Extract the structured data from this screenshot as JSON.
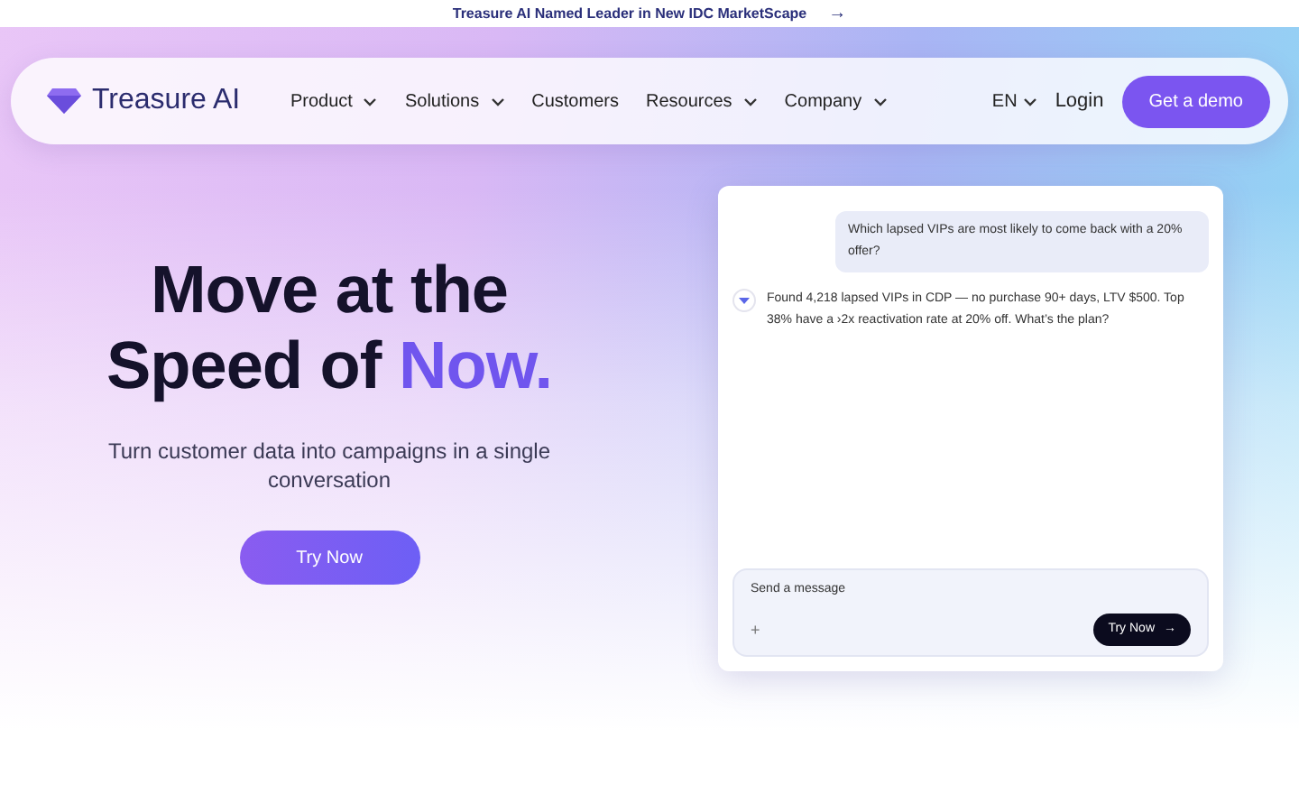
{
  "announcement": {
    "text": "Treasure AI Named Leader in New IDC MarketScape",
    "arrow": "→"
  },
  "nav": {
    "brand": "Treasure AI",
    "items": [
      {
        "label": "Product",
        "dropdown": true
      },
      {
        "label": "Solutions",
        "dropdown": true
      },
      {
        "label": "Customers",
        "dropdown": false
      },
      {
        "label": "Resources",
        "dropdown": true
      },
      {
        "label": "Company",
        "dropdown": true
      }
    ],
    "language": "EN",
    "login": "Login",
    "cta": "Get a demo"
  },
  "hero": {
    "headline": "Move at the Speed of",
    "highlight": "Now.",
    "subtitle": "Turn customer data into campaigns in a single conversation",
    "button": "Try Now"
  },
  "chat": {
    "messages": [
      {
        "kind": "user",
        "text": "Which lapsed VIPs are most likely to come back with a 20% offer?"
      },
      {
        "kind": "assistant",
        "text": "Found 4,218 lapsed VIPs in CDP — no purchase 90+ days, LTV $500. Top 38% have a ›2x reactivation rate at 20% off. What’s the plan?"
      }
    ],
    "input": {
      "placeholder": "Send a message",
      "plus": "+",
      "button": "Try Now",
      "arrow": "→"
    }
  }
}
